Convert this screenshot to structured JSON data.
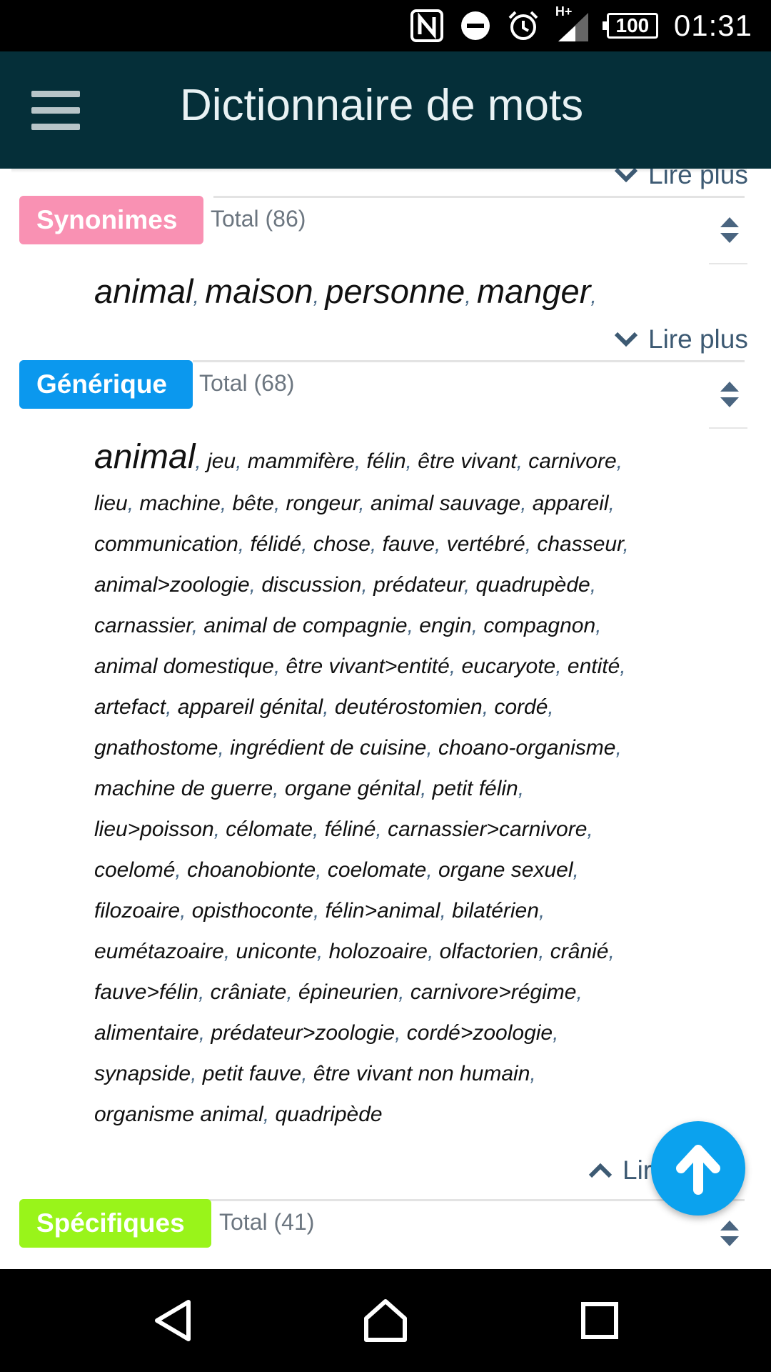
{
  "status_bar": {
    "network_label": "H+",
    "battery": "100",
    "time": "01:31",
    "icons": [
      "nfc-icon",
      "do-not-disturb-icon",
      "alarm-icon",
      "signal-icon",
      "battery-icon"
    ]
  },
  "app_bar": {
    "title": "Dictionnaire de mots",
    "menu_icon": "hamburger-menu-icon"
  },
  "lire_plus_top": "Lire plus",
  "sections": {
    "synonymes": {
      "tag": "Synonimes",
      "tag_color": "#f991b3",
      "total": "Total (86)",
      "lire_plus": "Lire plus",
      "words": [
        "animal",
        "maison",
        "personne",
        "manger"
      ]
    },
    "generique": {
      "tag": "Générique",
      "tag_color": "#0b98ee",
      "total": "Total (68)",
      "lire_moins": "Lire plus",
      "lines": [
        [
          "animal",
          "jeu",
          "mammifère",
          "félin",
          "être vivant",
          "carnivore"
        ],
        [
          "lieu",
          "machine",
          "bête",
          "rongeur",
          "animal sauvage",
          "appareil"
        ],
        [
          "communication",
          "félidé",
          "chose",
          "fauve",
          "vertébré",
          "chasseur"
        ],
        [
          "animal>zoologie",
          "discussion",
          "prédateur",
          "quadrupède"
        ],
        [
          "carnassier",
          "animal de compagnie",
          "engin",
          "compagnon"
        ],
        [
          "animal domestique",
          "être vivant>entité",
          "eucaryote",
          "entité"
        ],
        [
          "artefact",
          "appareil génital",
          "deutérostomien",
          "cordé"
        ],
        [
          "gnathostome",
          "ingrédient de cuisine",
          "choano-organisme"
        ],
        [
          "machine de guerre",
          "organe génital",
          "petit félin"
        ],
        [
          "lieu>poisson",
          "célomate",
          "féliné",
          "carnassier>carnivore"
        ],
        [
          "coelomé",
          "choanobionte",
          "coelomate",
          "organe sexuel"
        ],
        [
          "filozoaire",
          "opisthoconte",
          "félin>animal",
          "bilatérien"
        ],
        [
          "eumétazoaire",
          "uniconte",
          "holozoaire",
          "olfactorien",
          "crânié"
        ],
        [
          "fauve>félin",
          "crâniate",
          "épineurien",
          "carnivore>régime"
        ],
        [
          "alimentaire",
          "prédateur>zoologie",
          "cordé>zoologie"
        ],
        [
          "synapside",
          "petit fauve",
          "être vivant non humain"
        ],
        [
          "organisme animal",
          "quadripède"
        ]
      ]
    },
    "specifiques": {
      "tag": "Spécifiques",
      "tag_color": "#99f41a",
      "total": "Total (41)"
    }
  },
  "fab": {
    "icon": "arrow-up-icon",
    "color": "#0ba2ee"
  },
  "nav_bar": {
    "icons": [
      "back-icon",
      "home-icon",
      "recents-icon"
    ]
  }
}
